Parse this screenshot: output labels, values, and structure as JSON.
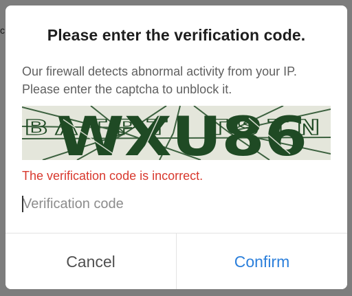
{
  "backdrop": {
    "peek_text": "c"
  },
  "dialog": {
    "title": "Please enter the verification code.",
    "message_line1": "Our firewall detects abnormal activity from your IP.",
    "message_line2": "Please enter the captcha to unblock it.",
    "captcha": {
      "main_text": "WXU86",
      "noise_text": "BATPT  TSTN"
    },
    "error_text": "The verification code is incorrect.",
    "input": {
      "value": "",
      "placeholder": "Verification code"
    },
    "buttons": {
      "cancel_label": "Cancel",
      "confirm_label": "Confirm"
    },
    "colors": {
      "error": "#d8382d",
      "confirm": "#2b7fdb",
      "captcha_ink": "#1f4a24",
      "captcha_bg": "#e4e6db"
    }
  }
}
